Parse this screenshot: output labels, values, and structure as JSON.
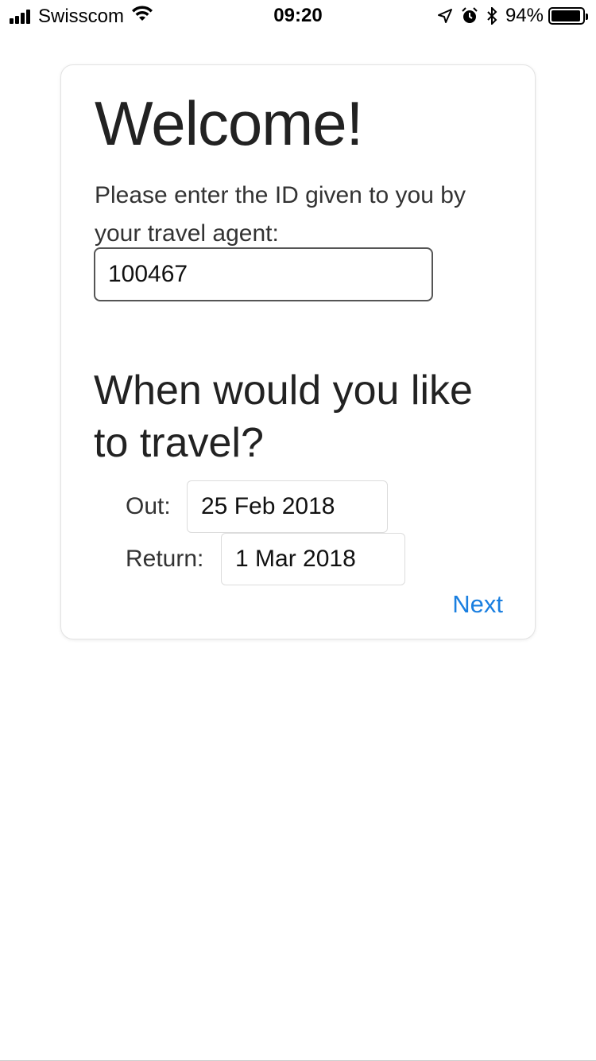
{
  "status_bar": {
    "carrier": "Swisscom",
    "time": "09:20",
    "battery_percent": "94%",
    "battery_level": 0.94,
    "icons": [
      "signal-icon",
      "wifi-icon",
      "location-icon",
      "alarm-icon",
      "bluetooth-icon",
      "battery-icon"
    ]
  },
  "card": {
    "title": "Welcome!",
    "prompt": "Please enter the ID given to you by your travel agent:",
    "id_value": "100467",
    "travel_heading": "When would you like to travel?",
    "out_label": "Out:",
    "out_date": "25 Feb 2018",
    "return_label": "Return:",
    "return_date": "1 Mar 2018",
    "next_label": "Next"
  },
  "colors": {
    "accent": "#1a7fe0",
    "text": "#222222"
  }
}
